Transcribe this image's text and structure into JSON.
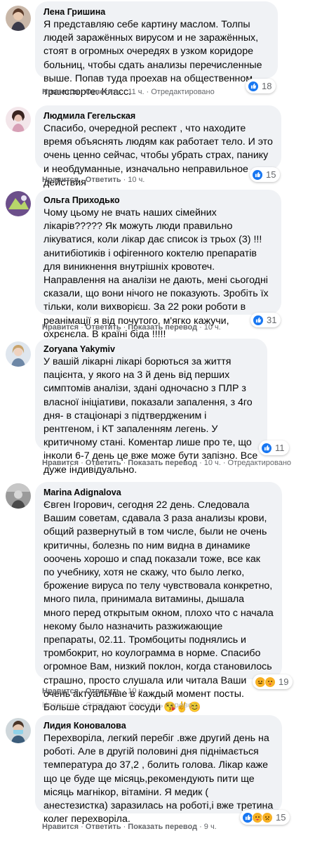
{
  "actions": {
    "like": "Нравится",
    "reply": "Ответить",
    "translate": "Показать перевод",
    "edited": "Отредактировано",
    "dot": "·"
  },
  "comments": [
    {
      "author": "Лена Гришина",
      "text": "Я представляю себе картину маслом. Толпы людей заражённых вирусом и не заражённых, стоят в огромных очередях в узком коридоре больниц, чтобы сдать анализы перечисленные выше. Попав туда проехав на общественном транспорте. Класс.",
      "time": "11 ч.",
      "reactions_count": "18",
      "reactions": [
        "like-icon"
      ]
    },
    {
      "author": "Людмила Гегельская",
      "text": "Спасибо, очередной респект , что находите время объяснять людям как работает тело. И это очень ценно сейчас, чтобы убрать страх, панику и необдуманные, изначально неправильное действия",
      "time": "10 ч.",
      "reactions_count": "15",
      "reactions": [
        "like-icon"
      ]
    },
    {
      "author": "Ольга Приходько",
      "text": "Чому цьому не вчать наших сімейних лікарів????? Як можуть люди правильно лікуватися, коли лікар дає список із трьох (3) !!! анитибіотиків і офігенного коктелю препаратів для виникнення внутрішніх кровотеч. Направлення на аналізи не дають, мені сьогодні сказали, що вони нічого не показують. Зробіть їх тільки, коли вихворієш. За 22 роки роботи в реанімації я від почутого, м'ягко кажучи, охрєнєла. В країні біда !!!!!",
      "time": "10 ч.",
      "reactions_count": "31",
      "reactions": [
        "like-icon"
      ]
    },
    {
      "author": "Zoryana Yakymiv",
      "text": "У вашій лікарні лікарі борються за життя пацієнта, у якого на 3 й день від перших симптомів аналізи, здані одночасно з ПЛР з власної ініціативи, показали запалення, з 4го дня- в стаціонарі з підтвердженим і рентгеном, і КТ запаленням легень. У критичному стані. Коментар лише про те, що інколи 6-7 день це вже може бути запізно. Все дуже індивідуально.",
      "time": "10 ч.",
      "reactions_count": "11",
      "reactions": [
        "like-icon"
      ]
    },
    {
      "author": "Marina Adignalova",
      "text": "Євген Ігорович, сегодня 22 день. Следовала Вашим советам, сдавала 3 раза анализы крови, общий развернутый в том числе, были не очень критичны, болезнь по ним видна в динамике ооочень хорошо и спад показали тоже, все как по учебнику, хотя не скажу, что было легко, брожение вируса по телу чувствовала конкретно, много пила, принимала витамины, дышала много перед открытым окном, плохо что с начала некому было назначить разжижающие препараты, 02.11. Тромбоциты поднялись и тромбокрит, но коулограмма в норме. Спасибо огромное Вам, низкий поклон, когда становилось страшно, просто слушала или читала Ваши очень актуальные в каждый момент посты. Больше страдают сосуди",
      "emoji": "😘✌️😊",
      "time": "10 ч.",
      "reactions_count": "19",
      "reactions": [
        "haha-icon",
        "care-icon"
      ]
    },
    {
      "author": "Лидия Коновалова",
      "text": "Перехворіла, легкий перебіг .вже другий день на роботі. Але в другій половині дня піднімається температура до 37,2 , болить голова. Лікар каже що це буде ще місяць,рекомендують пити ще місяць магнікор, вітаміни. Я медик ( анестезистка) заразилась на роботі,і вже третина колег перехворіла.",
      "time": "9 ч.",
      "reactions_count": "15",
      "reactions": [
        "like-icon",
        "care-icon",
        "sad-icon"
      ]
    }
  ],
  "colors": {
    "bubble": "#f0f2f5",
    "meta": "#65676b",
    "like": "#1877f2",
    "emoji": "#f7b125"
  }
}
